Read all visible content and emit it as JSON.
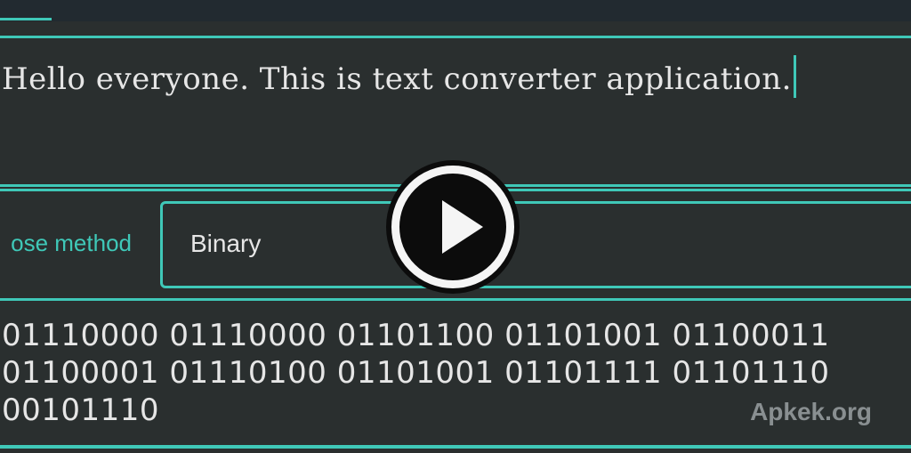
{
  "input": {
    "text": "Hello everyone. This is text converter application."
  },
  "method": {
    "label": "ose method",
    "selected": "Binary"
  },
  "output": {
    "text": "01110000 01110000 01101100 01101001 01100011\n01100001 01110100 01101001 01101111 01101110\n00101110"
  },
  "overlay": {
    "icon": "play-icon"
  },
  "watermark": "Apkek.org",
  "colors": {
    "accent": "#3fc8b8",
    "background": "#2a2f2f",
    "text": "#e6e6e6"
  }
}
